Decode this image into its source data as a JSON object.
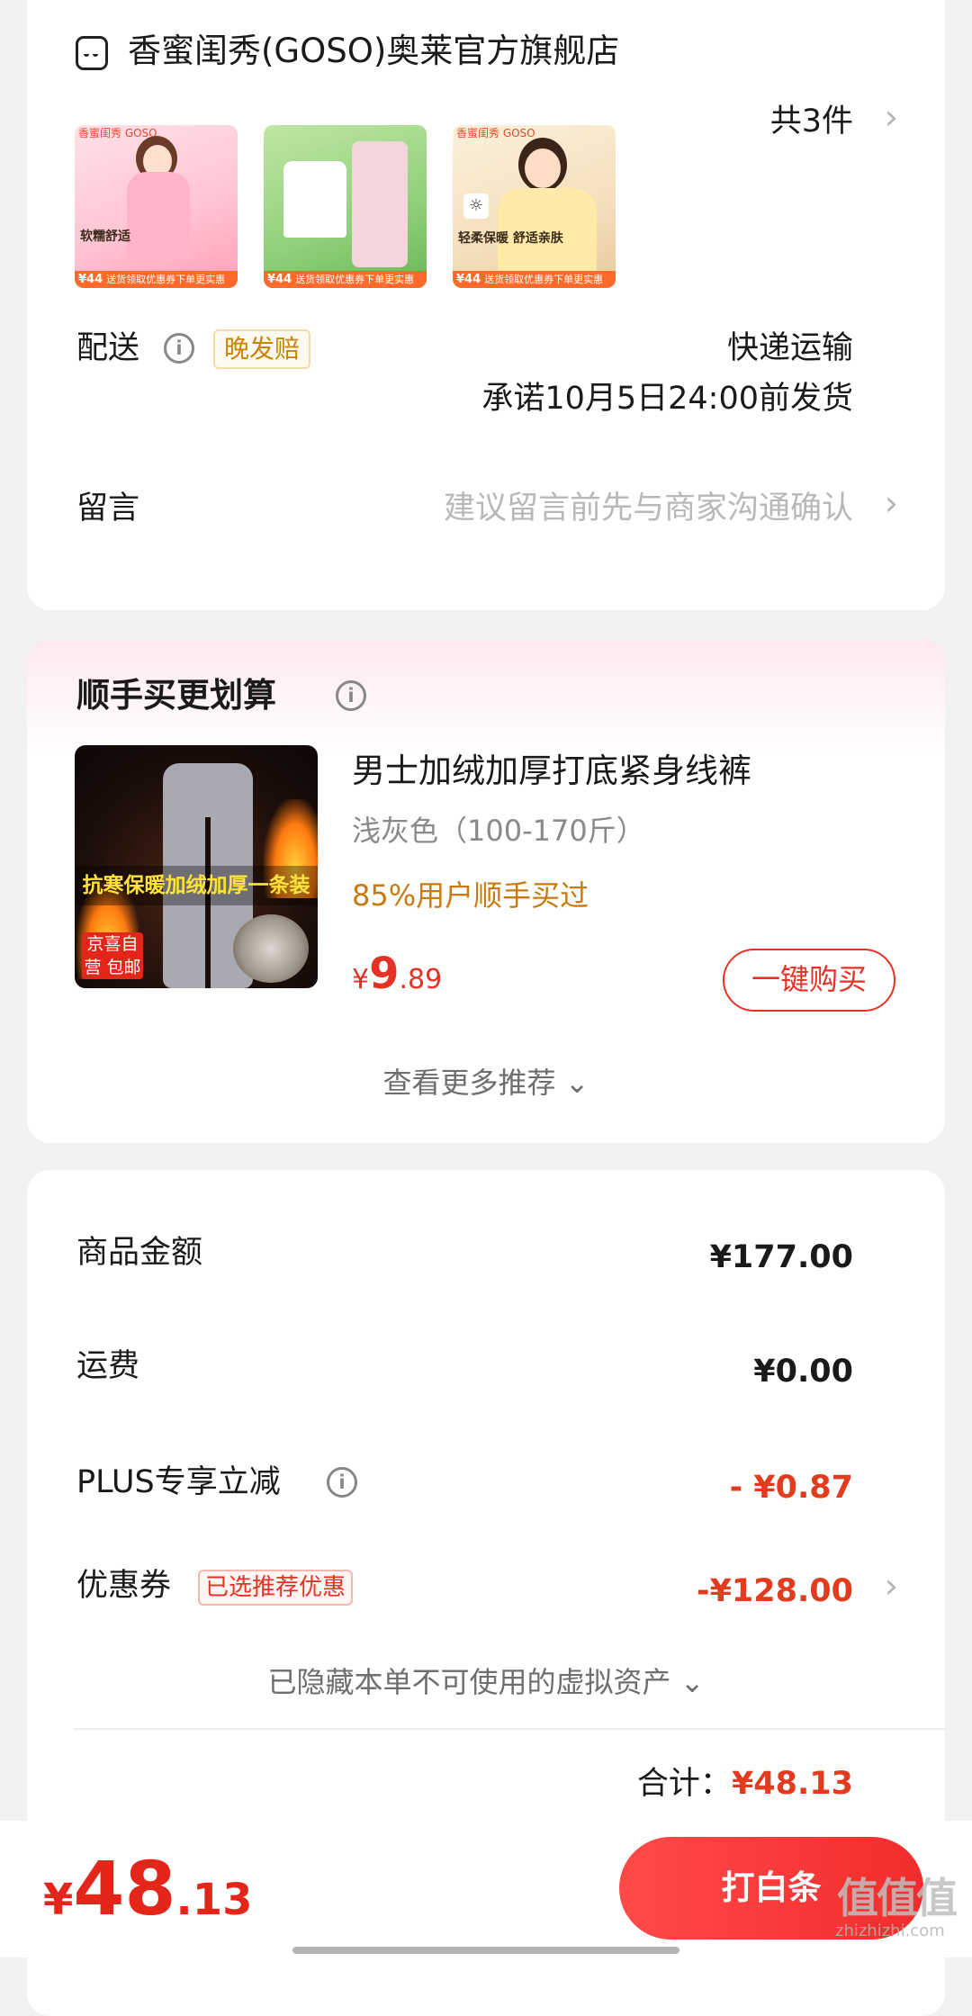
{
  "store": {
    "name": "香蜜闺秀(GOSO)奥莱官方旗舰店",
    "icon": "store-icon"
  },
  "items": {
    "count_label": "共3件",
    "thumbs": [
      {
        "brand": "香蜜闺秀 GOSO",
        "caption": "软糯舒适",
        "price_tag": "¥44",
        "bar_text": "送货领取优惠券下单更实惠"
      },
      {
        "brand": "",
        "caption": "",
        "price_tag": "¥44",
        "bar_text": "送货领取优惠券下单更实惠"
      },
      {
        "brand": "香蜜闺秀 GOSO",
        "caption": "轻柔保暖 舒适亲肤",
        "price_tag": "¥44",
        "bar_text": "送货领取优惠券下单更实惠"
      }
    ]
  },
  "delivery": {
    "label": "配送",
    "badge": "晚发赔",
    "method": "快递运输",
    "promise": "承诺10月5日24:00前发货"
  },
  "message": {
    "label": "留言",
    "placeholder": "建议留言前先与商家沟通确认"
  },
  "recommend": {
    "title": "顺手买更划算",
    "product": {
      "title": "男士加绒加厚打底紧身线裤",
      "sku": "浅灰色（100-170斤）",
      "popularity": "85%用户顺手买过",
      "currency": "¥",
      "price_int": "9",
      "price_dec": ".89",
      "image_banner": "抗寒保暖加绒加厚一条装",
      "image_tag": "京喜自营 包邮"
    },
    "buy_button": "一键购买",
    "more": "查看更多推荐"
  },
  "summary": {
    "goods_label": "商品金额",
    "goods_value": "¥177.00",
    "shipping_label": "运费",
    "shipping_value": "¥0.00",
    "plus_label": "PLUS专享立减",
    "plus_value": "- ¥0.87",
    "coupon_label": "优惠券",
    "coupon_badge": "已选推荐优惠",
    "coupon_value": "-¥128.00",
    "hidden_assets": "已隐藏本单不可使用的虚拟资产",
    "total_label": "合计：",
    "total_value": "¥48.13"
  },
  "bottom_bar": {
    "currency": "¥",
    "price_int": "48",
    "price_dec": ".13",
    "pay_button": "打白条"
  },
  "watermark": {
    "logo": "值值值",
    "domain": "zhizhizhi.com"
  },
  "colors": {
    "accent": "#e33324",
    "gold": "#c77a12",
    "background": "#f2f2f2"
  }
}
